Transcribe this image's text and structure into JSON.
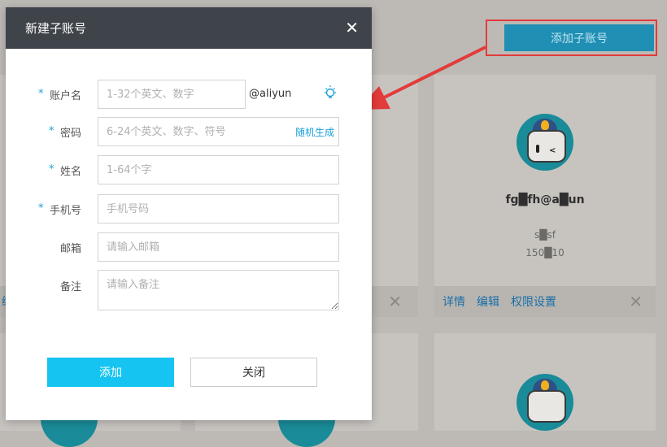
{
  "modal": {
    "title": "新建子账号",
    "close_glyph": "✕",
    "fields": [
      {
        "label": "账户名",
        "required": true,
        "placeholder": "1-32个英文、数字",
        "suffix": "@aliyun"
      },
      {
        "label": "密码",
        "required": true,
        "placeholder": "6-24个英文、数字、符号",
        "action": "随机生成"
      },
      {
        "label": "姓名",
        "required": true,
        "placeholder": "1-64个字"
      },
      {
        "label": "手机号",
        "required": true,
        "placeholder": "手机号码"
      },
      {
        "label": "邮箱",
        "required": false,
        "placeholder": "请输入邮箱"
      },
      {
        "label": "备注",
        "required": false,
        "placeholder": "请输入备注"
      }
    ],
    "required_mark": "*",
    "submit_label": "添加",
    "cancel_label": "关闭"
  },
  "page": {
    "add_sub_account_label": "添加子账号",
    "card": {
      "name": "fg█fh@a█un",
      "line1": "s█sf",
      "line2": "150█10",
      "actions": [
        "详情",
        "编辑",
        "权限设置"
      ],
      "close_glyph": "✕"
    },
    "left_card_action_fragment": "编"
  },
  "colors": {
    "accent": "#15c4f0",
    "header_bg": "#3f434a",
    "highlight_border": "#e23b3b",
    "link": "#1aa0d8"
  }
}
